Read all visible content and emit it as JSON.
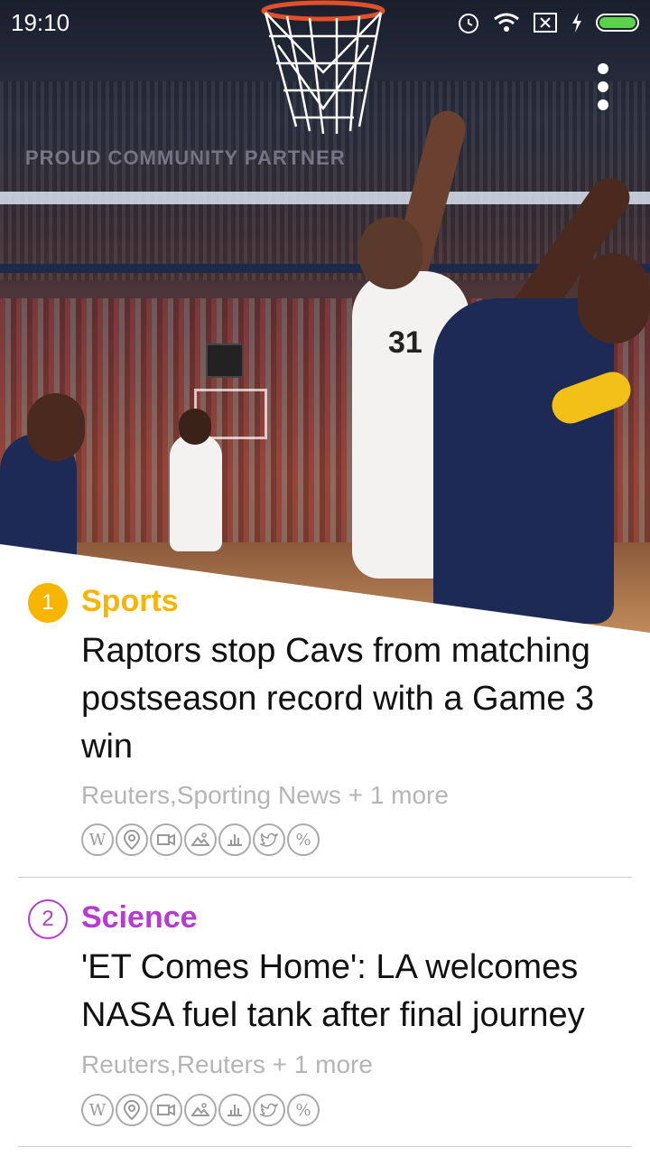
{
  "status_bar": {
    "time": "19:10",
    "icons": [
      "alarm-icon",
      "wifi-icon",
      "sim-off-icon",
      "charging-icon",
      "battery-icon"
    ],
    "battery_color": "#5ad24a"
  },
  "hero": {
    "background_signage": "PROUD COMMUNITY PARTNER",
    "jersey_number": "31"
  },
  "articles": [
    {
      "rank": "1",
      "category": "Sports",
      "category_color": "#f7b500",
      "title": "Raptors stop Cavs from matching postseason record with a Game 3 win",
      "sources": "Reuters,Sporting News + 1 more",
      "tool_icons": [
        "wikipedia-icon",
        "location-icon",
        "video-icon",
        "image-icon",
        "timeline-icon",
        "twitter-icon",
        "percent-icon"
      ]
    },
    {
      "rank": "2",
      "category": "Science",
      "category_color": "#b53ccf",
      "title": "'ET Comes Home': LA welcomes NASA fuel tank after final journey",
      "sources": "Reuters,Reuters + 1 more",
      "tool_icons": [
        "wikipedia-icon",
        "location-icon",
        "video-icon",
        "image-icon",
        "timeline-icon",
        "twitter-icon",
        "percent-icon"
      ]
    }
  ]
}
